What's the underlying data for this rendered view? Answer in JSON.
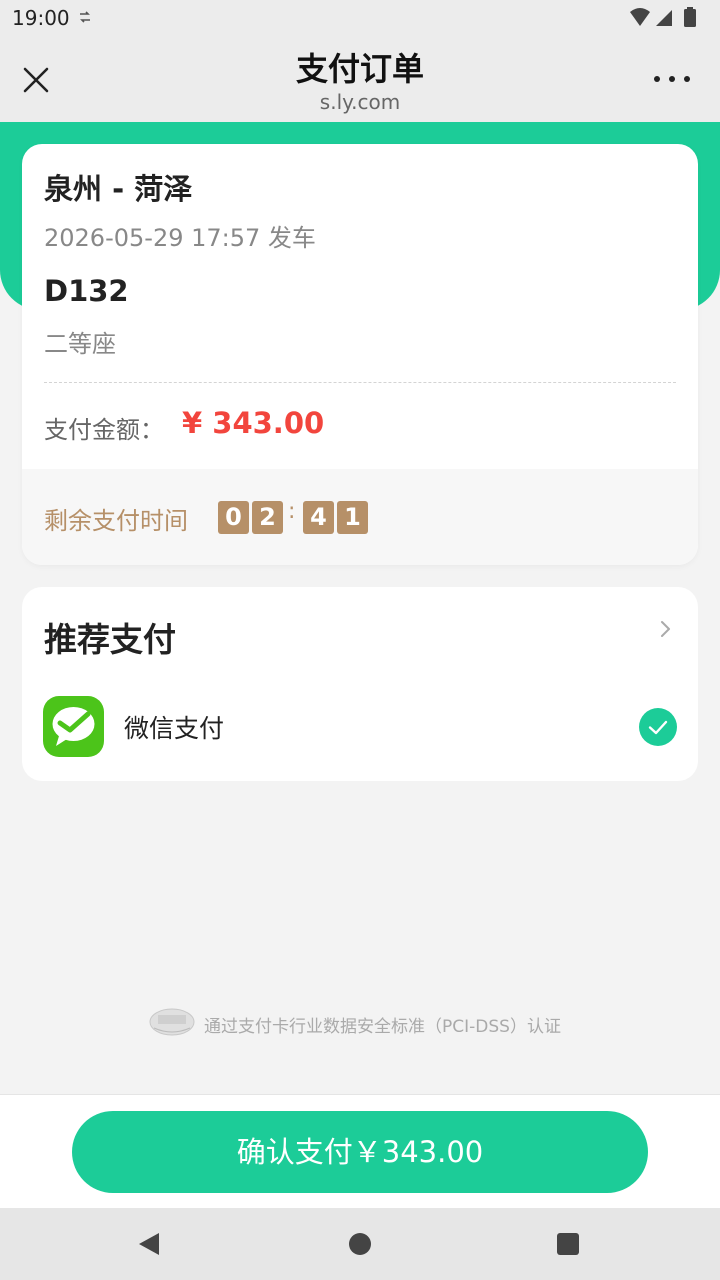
{
  "status_bar": {
    "time": "19:00"
  },
  "header": {
    "title": "支付订单",
    "subtitle": "s.ly.com"
  },
  "order": {
    "route": "泉州 - 菏泽",
    "departure": "2026-05-29 17:57 发车",
    "train_number": "D132",
    "seat_class": "二等座",
    "amount_label": "支付金额：",
    "amount_value": "¥ 343.00",
    "remaining_label": "剩余支付时间",
    "timer_digits": [
      "0",
      "2",
      "4",
      "1"
    ],
    "timer_separator": ":"
  },
  "payment": {
    "section_title": "推荐支付",
    "method_label": "微信支付",
    "method_selected": true
  },
  "security_note": "通过支付卡行业数据安全标准（PCI-DSS）认证",
  "confirm_button": "确认支付￥343.00",
  "colors": {
    "brand_green": "#1ccc98",
    "price_red": "#f2453d",
    "timer_brown": "#b69068",
    "wechat_green": "#4cc41a"
  },
  "icons": [
    "close-icon",
    "more-icon",
    "chevron-right-icon",
    "wechat-pay-icon",
    "check-circle-icon",
    "pci-dss-logo",
    "nav-back-icon",
    "nav-home-icon",
    "nav-recent-icon"
  ]
}
